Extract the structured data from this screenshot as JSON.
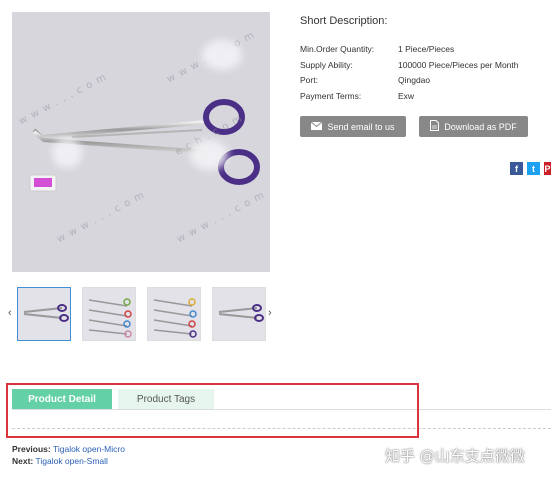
{
  "product": {
    "short_description_label": "Short Description:",
    "specs": [
      {
        "label": "Min.Order Quantity:",
        "value": "1 Piece/Pieces"
      },
      {
        "label": "Supply Ability:",
        "value": "100000 Piece/Pieces per Month"
      },
      {
        "label": "Port:",
        "value": "Qingdao"
      },
      {
        "label": "Payment Terms:",
        "value": "Exw"
      }
    ],
    "buttons": {
      "email": "Send email to us",
      "pdf": "Download as PDF"
    },
    "social": {
      "facebook": "f",
      "twitter": "t",
      "pinterest": "P"
    }
  },
  "gallery": {
    "watermark": "w w w . . . c o m",
    "watermark2": "e c h . c o m",
    "prev_arrow": "‹",
    "next_arrow": "›",
    "thumb_count": 4
  },
  "tabs": {
    "detail": "Product Detail",
    "tags": "Product Tags"
  },
  "navigation": {
    "previous_label": "Previous:",
    "previous_link": "Tigalok open-Micro",
    "next_label": "Next:",
    "next_link": "Tigalok open-Small"
  },
  "overlay": {
    "zhihu": "知乎 @山东支点微微"
  },
  "colors": {
    "tab_active": "#63d0a6",
    "tab_inactive": "#e6f6ef",
    "button": "#888888",
    "link": "#2b5fb6",
    "highlight_border": "#d8363c",
    "handle": "#4b2f86"
  }
}
